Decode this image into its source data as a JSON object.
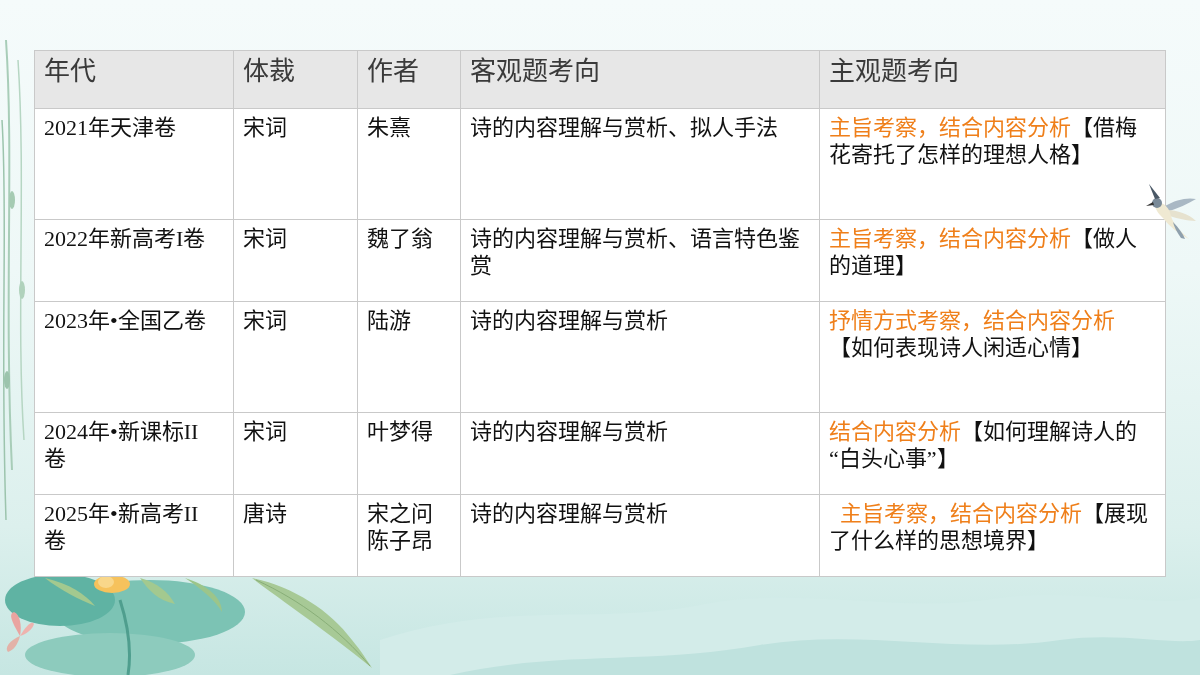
{
  "table": {
    "columns": [
      "年代",
      "体裁",
      "作者",
      "客观题考向",
      "主观题考向"
    ],
    "rows": [
      {
        "year": "2021年天津卷",
        "genre": "宋词",
        "author": "朱熹",
        "objective": "诗的内容理解与赏析、拟人手法",
        "subjective": {
          "focus": "主旨考察，结合内容分析",
          "question": "【借梅花寄托了怎样的理想人格】"
        }
      },
      {
        "year": "2022年新高考I卷",
        "genre": "宋词",
        "author": "魏了翁",
        "objective": "诗的内容理解与赏析、语言特色鉴赏",
        "subjective": {
          "focus": "主旨考察，结合内容分析",
          "question": "【做人的道理】"
        }
      },
      {
        "year": "2023年•全国乙卷",
        "genre": "宋词",
        "author": "陆游",
        "objective": "诗的内容理解与赏析",
        "subjective": {
          "focus": "抒情方式考察，结合内容分析",
          "question": "【如何表现诗人闲适心情】"
        }
      },
      {
        "year": "2024年•新课标II卷",
        "genre": "宋词",
        "author": "叶梦得",
        "objective": "诗的内容理解与赏析",
        "subjective": {
          "focus": "结合内容分析",
          "question": "【如何理解诗人的“白头心事”】"
        }
      },
      {
        "year": "2025年•新高考II卷",
        "genre": "唐诗",
        "author": "宋之问陈子昂",
        "objective": "诗的内容理解与赏析",
        "subjective": {
          "focus": "  主旨考察，结合内容分析",
          "question": "【展现了什么样的思想境界】"
        }
      }
    ]
  }
}
